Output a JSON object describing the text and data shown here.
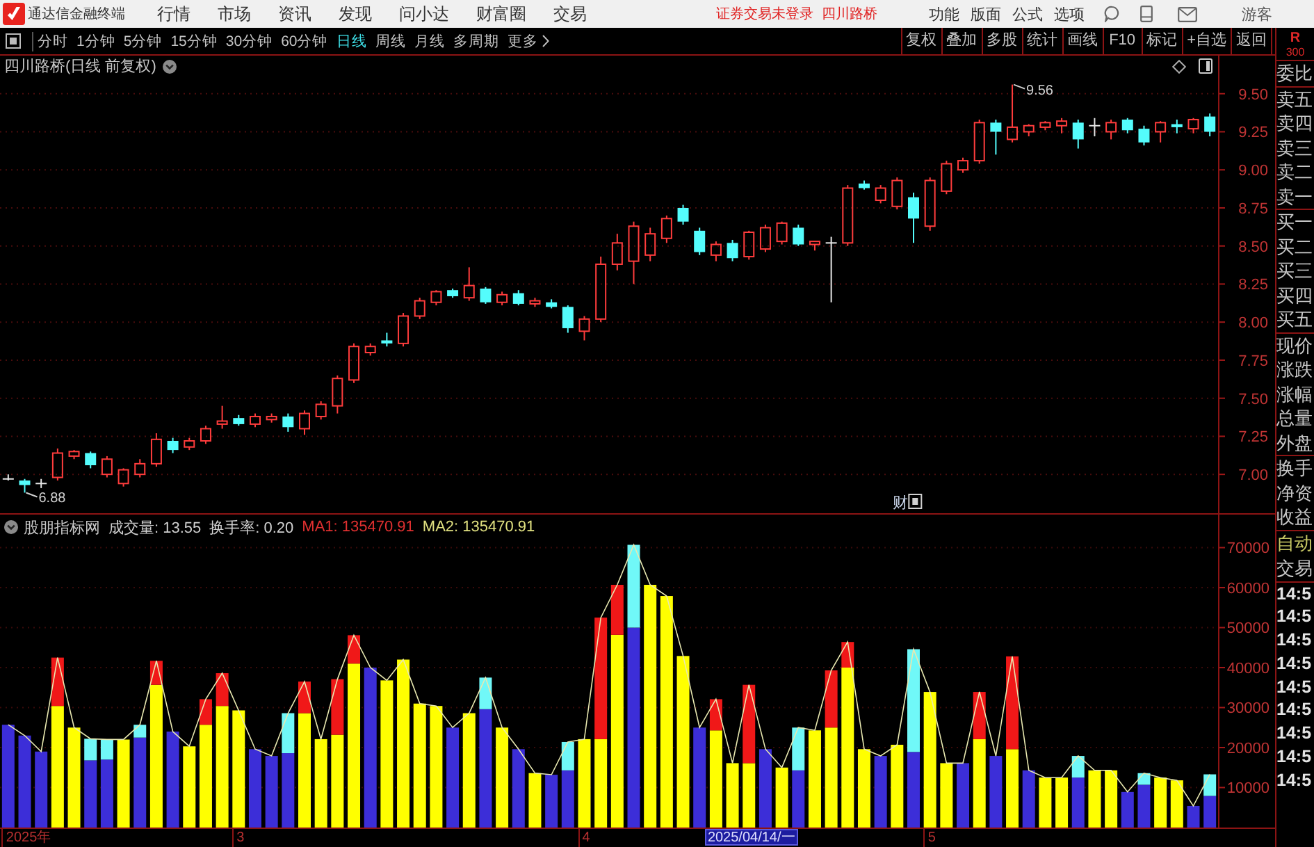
{
  "title_bar": {
    "app_name": "通达信金融终端",
    "menus": [
      "行情",
      "市场",
      "资讯",
      "发现",
      "问小达",
      "财富圈",
      "交易"
    ],
    "login_status": "证券交易未登录",
    "stock_name": "四川路桥",
    "right_menus": [
      "功能",
      "版面",
      "公式",
      "选项"
    ],
    "user": "游客"
  },
  "period_tabs": [
    {
      "label": "分时",
      "kind": "period",
      "selected": false
    },
    {
      "label": "1分钟",
      "kind": "period",
      "selected": false
    },
    {
      "label": "5分钟",
      "kind": "period",
      "selected": false
    },
    {
      "label": "15分钟",
      "kind": "period",
      "selected": false
    },
    {
      "label": "30分钟",
      "kind": "period",
      "selected": false
    },
    {
      "label": "60分钟",
      "kind": "period",
      "selected": false
    },
    {
      "label": "日线",
      "kind": "period",
      "selected": true
    },
    {
      "label": "周线",
      "kind": "period",
      "selected": false
    },
    {
      "label": "月线",
      "kind": "period",
      "selected": false
    },
    {
      "label": "多周期",
      "kind": "period",
      "selected": false
    },
    {
      "label": "更多",
      "kind": "menu",
      "selected": false
    }
  ],
  "tool_buttons": [
    "复权",
    "叠加",
    "多股",
    "统计",
    "画线",
    "F10",
    "标记",
    "+自选",
    "返回"
  ],
  "price_chart": {
    "title": "四川路桥(日线 前复权)",
    "event_marker": "财",
    "chart_data": {
      "type": "candlestick",
      "categories": [
        null,
        null,
        null,
        null,
        null,
        null,
        null,
        null,
        null,
        null,
        null,
        null,
        null,
        null,
        null,
        null,
        null,
        null,
        null,
        null,
        null,
        null,
        null,
        null,
        null,
        null,
        null,
        null,
        null,
        null,
        null,
        null,
        null,
        null,
        null,
        null,
        null,
        null,
        null,
        null,
        null,
        null,
        null,
        null,
        null,
        null,
        null,
        null,
        null,
        null,
        null,
        null,
        null,
        null,
        null,
        null,
        null,
        null,
        null,
        null,
        null,
        null,
        null,
        null,
        null,
        null,
        null,
        null,
        null,
        null,
        null,
        null,
        null,
        null
      ],
      "ohlc": [
        [
          6.97,
          7.0,
          6.96,
          6.97
        ],
        [
          6.96,
          6.97,
          6.88,
          6.93
        ],
        [
          6.94,
          6.97,
          6.91,
          6.94
        ],
        [
          6.98,
          7.17,
          6.96,
          7.14
        ],
        [
          7.12,
          7.16,
          7.1,
          7.15
        ],
        [
          7.14,
          7.15,
          7.04,
          7.06
        ],
        [
          7.0,
          7.12,
          6.98,
          7.1
        ],
        [
          6.94,
          7.04,
          6.92,
          7.03
        ],
        [
          7.0,
          7.1,
          6.98,
          7.07
        ],
        [
          7.07,
          7.27,
          7.05,
          7.23
        ],
        [
          7.22,
          7.24,
          7.14,
          7.16
        ],
        [
          7.18,
          7.24,
          7.16,
          7.22
        ],
        [
          7.22,
          7.32,
          7.2,
          7.3
        ],
        [
          7.33,
          7.45,
          7.3,
          7.35
        ],
        [
          7.37,
          7.39,
          7.32,
          7.33
        ],
        [
          7.33,
          7.4,
          7.31,
          7.38
        ],
        [
          7.36,
          7.4,
          7.34,
          7.38
        ],
        [
          7.38,
          7.4,
          7.28,
          7.31
        ],
        [
          7.3,
          7.42,
          7.26,
          7.4
        ],
        [
          7.38,
          7.48,
          7.36,
          7.46
        ],
        [
          7.45,
          7.65,
          7.4,
          7.63
        ],
        [
          7.62,
          7.86,
          7.6,
          7.84
        ],
        [
          7.8,
          7.86,
          7.78,
          7.84
        ],
        [
          7.88,
          7.93,
          7.84,
          7.86
        ],
        [
          7.86,
          8.06,
          7.84,
          8.04
        ],
        [
          8.04,
          8.16,
          8.02,
          8.14
        ],
        [
          8.13,
          8.21,
          8.11,
          8.2
        ],
        [
          8.21,
          8.22,
          8.16,
          8.17
        ],
        [
          8.16,
          8.36,
          8.14,
          8.24
        ],
        [
          8.22,
          8.23,
          8.12,
          8.13
        ],
        [
          8.13,
          8.2,
          8.11,
          8.18
        ],
        [
          8.19,
          8.21,
          8.11,
          8.12
        ],
        [
          8.12,
          8.16,
          8.1,
          8.14
        ],
        [
          8.13,
          8.15,
          8.09,
          8.1
        ],
        [
          8.1,
          8.11,
          7.93,
          7.96
        ],
        [
          7.94,
          8.04,
          7.88,
          8.02
        ],
        [
          8.02,
          8.43,
          8.0,
          8.38
        ],
        [
          8.38,
          8.58,
          8.34,
          8.52
        ],
        [
          8.4,
          8.66,
          8.25,
          8.63
        ],
        [
          8.44,
          8.62,
          8.4,
          8.58
        ],
        [
          8.55,
          8.7,
          8.52,
          8.68
        ],
        [
          8.75,
          8.77,
          8.64,
          8.66
        ],
        [
          8.6,
          8.62,
          8.44,
          8.46
        ],
        [
          8.44,
          8.53,
          8.4,
          8.51
        ],
        [
          8.52,
          8.54,
          8.4,
          8.42
        ],
        [
          8.43,
          8.6,
          8.41,
          8.59
        ],
        [
          8.48,
          8.64,
          8.46,
          8.62
        ],
        [
          8.53,
          8.66,
          8.51,
          8.65
        ],
        [
          8.62,
          8.64,
          8.5,
          8.51
        ],
        [
          8.51,
          8.53,
          8.47,
          8.53
        ],
        [
          8.52,
          8.56,
          8.13,
          8.52
        ],
        [
          8.52,
          8.9,
          8.5,
          8.88
        ],
        [
          8.91,
          8.93,
          8.87,
          8.88
        ],
        [
          8.8,
          8.9,
          8.78,
          8.88
        ],
        [
          8.76,
          8.95,
          8.74,
          8.93
        ],
        [
          8.82,
          8.85,
          8.52,
          8.68
        ],
        [
          8.63,
          8.95,
          8.6,
          8.93
        ],
        [
          8.86,
          9.06,
          8.84,
          9.04
        ],
        [
          9.0,
          9.08,
          8.98,
          9.06
        ],
        [
          9.06,
          9.33,
          9.04,
          9.31
        ],
        [
          9.31,
          9.33,
          9.1,
          9.25
        ],
        [
          9.2,
          9.56,
          9.18,
          9.28
        ],
        [
          9.25,
          9.3,
          9.22,
          9.29
        ],
        [
          9.28,
          9.32,
          9.26,
          9.31
        ],
        [
          9.29,
          9.34,
          9.24,
          9.32
        ],
        [
          9.31,
          9.33,
          9.14,
          9.2
        ],
        [
          9.29,
          9.34,
          9.22,
          9.29
        ],
        [
          9.25,
          9.33,
          9.2,
          9.31
        ],
        [
          9.33,
          9.34,
          9.24,
          9.26
        ],
        [
          9.27,
          9.29,
          9.16,
          9.18
        ],
        [
          9.25,
          9.32,
          9.18,
          9.31
        ],
        [
          9.3,
          9.33,
          9.24,
          9.28
        ],
        [
          9.27,
          9.34,
          9.24,
          9.33
        ],
        [
          9.35,
          9.37,
          9.22,
          9.25
        ]
      ],
      "ylim": [
        6.745,
        9.75
      ],
      "yticks": [
        {
          "value": 9.5,
          "label": "9.50"
        },
        9.25,
        {
          "value": 9,
          "label": "9.00"
        },
        8.75,
        {
          "value": 8.5,
          "label": "8.50"
        },
        8.25,
        {
          "value": 8,
          "label": "8.00"
        },
        7.75,
        {
          "value": 7.5,
          "label": "7.50"
        },
        7.25,
        {
          "value": 7,
          "label": "7.00"
        }
      ],
      "grid": true,
      "annotations": [
        "9.56",
        "6.88"
      ]
    }
  },
  "indicator": {
    "name": "股朋指标网",
    "readouts": [
      {
        "text": "成交量: 13.55",
        "color": "#d0d0d0"
      },
      {
        "text": "换手率: 0.20",
        "color": "#d0d0d0"
      },
      {
        "text": "MA1: 135470.91",
        "color": "#e03030"
      },
      {
        "text": "MA2: 135470.91",
        "color": "#e0e080"
      }
    ],
    "chart_data": {
      "type": "bar",
      "stacked": true,
      "grid": true,
      "series": [
        {
          "color": "#3c2ed8",
          "values": [
            25700,
            23000,
            19000,
            null,
            null,
            16800,
            17000,
            null,
            22500,
            null,
            24000,
            null,
            null,
            null,
            null,
            19600,
            17900,
            18600,
            null,
            null,
            null,
            null,
            40000,
            null,
            null,
            null,
            null,
            25000,
            null,
            29600,
            null,
            19600,
            null,
            13200,
            14300,
            null,
            null,
            null,
            50000,
            null,
            null,
            null,
            25000,
            null,
            null,
            null,
            19600,
            null,
            14300,
            null,
            null,
            null,
            null,
            17900,
            null,
            18900,
            null,
            null,
            16100,
            null,
            17900,
            null,
            14300,
            null,
            null,
            12500,
            null,
            null,
            8900,
            10700,
            null,
            null,
            5400,
            7900
          ]
        },
        {
          "color": "#ffff00",
          "values": [
            null,
            null,
            null,
            30400,
            25000,
            null,
            null,
            22000,
            null,
            35700,
            null,
            20300,
            25700,
            30400,
            29300,
            null,
            null,
            null,
            28600,
            22100,
            23200,
            41000,
            null,
            36800,
            42000,
            31000,
            30400,
            null,
            28600,
            null,
            25000,
            null,
            13600,
            null,
            null,
            22100,
            22100,
            48200,
            null,
            60700,
            57900,
            42900,
            null,
            24300,
            16100,
            16100,
            null,
            15000,
            null,
            24300,
            25000,
            40000,
            19600,
            null,
            20700,
            null,
            33900,
            16100,
            null,
            22100,
            null,
            19600,
            null,
            12500,
            12500,
            null,
            14300,
            14300,
            null,
            null,
            12500,
            11800,
            null,
            null
          ]
        },
        {
          "color": "#f01818",
          "values": [
            null,
            null,
            null,
            12100,
            null,
            null,
            null,
            null,
            null,
            6000,
            null,
            null,
            6400,
            8200,
            null,
            null,
            null,
            null,
            7900,
            null,
            13900,
            7100,
            null,
            null,
            null,
            null,
            null,
            null,
            null,
            null,
            null,
            null,
            null,
            null,
            null,
            null,
            30400,
            12500,
            null,
            null,
            null,
            null,
            null,
            7800,
            null,
            19600,
            null,
            null,
            null,
            null,
            14300,
            6400,
            null,
            null,
            null,
            null,
            null,
            null,
            null,
            11800,
            null,
            23200,
            null,
            null,
            null,
            null,
            null,
            null,
            null,
            null,
            null,
            null,
            null,
            null
          ]
        },
        {
          "color": "#70f8f8",
          "values": [
            null,
            null,
            null,
            null,
            null,
            5400,
            5000,
            null,
            3200,
            null,
            null,
            null,
            null,
            null,
            null,
            null,
            null,
            10000,
            null,
            null,
            null,
            null,
            null,
            null,
            null,
            null,
            null,
            null,
            null,
            7900,
            null,
            null,
            null,
            null,
            7100,
            null,
            null,
            null,
            20700,
            null,
            null,
            null,
            null,
            null,
            null,
            null,
            null,
            null,
            10700,
            null,
            null,
            null,
            null,
            null,
            null,
            25700,
            null,
            null,
            null,
            null,
            null,
            null,
            null,
            null,
            null,
            5400,
            null,
            null,
            null,
            2900,
            null,
            null,
            null,
            5400
          ]
        },
        {
          "type": "line",
          "color": "#e8e8b0",
          "values": [
            25700,
            23000,
            19000,
            42500,
            25000,
            22200,
            22000,
            22000,
            25700,
            41700,
            24000,
            20300,
            32100,
            38600,
            29300,
            19600,
            17900,
            28600,
            36500,
            22100,
            37100,
            48100,
            40000,
            36800,
            42000,
            31000,
            30400,
            25000,
            28600,
            37500,
            25000,
            19600,
            13600,
            13200,
            21400,
            22100,
            52500,
            60700,
            70700,
            60700,
            57900,
            42900,
            25000,
            32100,
            16100,
            35700,
            19600,
            15000,
            25000,
            24300,
            39300,
            46400,
            19600,
            17900,
            20700,
            44600,
            33900,
            16100,
            16100,
            33900,
            17900,
            42800,
            14300,
            12500,
            12500,
            17900,
            14300,
            14300,
            8900,
            13600,
            12500,
            11800,
            5400,
            13300
          ]
        }
      ],
      "ylim": [
        0,
        78260
      ],
      "yticks": [
        70000,
        60000,
        50000,
        40000,
        30000,
        20000,
        10000
      ]
    }
  },
  "date_axis": {
    "labels": [
      "2025年",
      "3",
      "4",
      "5"
    ],
    "cursor_label": "2025/04/14/一"
  },
  "side_panel": {
    "corner_letter": "R",
    "corner_number": "300",
    "groups": [
      [
        "委比"
      ],
      [
        "卖五",
        "卖四",
        "卖三",
        "卖二",
        "卖一"
      ],
      [
        "买一",
        "买二",
        "买三",
        "买四",
        "买五"
      ],
      [
        "现价",
        "涨跌",
        "涨幅",
        "总量",
        "外盘"
      ],
      [
        "换手",
        "净资",
        "收益"
      ]
    ],
    "trade_tabs": [
      {
        "label": "自动",
        "selected": true
      },
      {
        "label": "交易",
        "selected": false
      }
    ],
    "times": [
      "14:5",
      "14:5",
      "14:5",
      "14:5",
      "14:5",
      "14:5",
      "14:5",
      "14:5",
      "14:5"
    ]
  }
}
